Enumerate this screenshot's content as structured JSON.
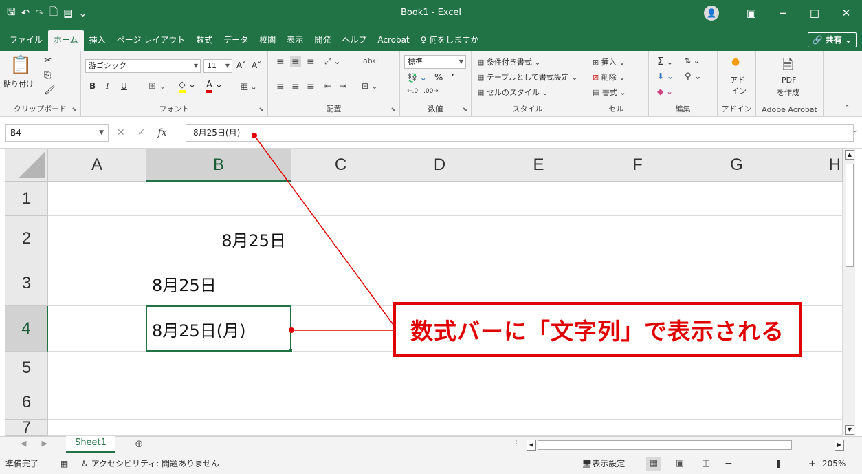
{
  "window": {
    "title": "Book1  -  Excel",
    "avatar_initial": "👤",
    "ribbon_display_icon": "ribbon-display-icon",
    "minimize": "−",
    "maximize": "□",
    "close": "✕"
  },
  "qat": {
    "save": "🖫",
    "undo": "↶",
    "redo": "↷",
    "preview": "🗋",
    "form": "▤",
    "more": "⌄"
  },
  "tabs": [
    "ファイル",
    "ホーム",
    "挿入",
    "ページ レイアウト",
    "数式",
    "データ",
    "校閲",
    "表示",
    "開発",
    "ヘルプ",
    "Acrobat",
    "♀ 何をしますか"
  ],
  "active_tab_index": 1,
  "share_label": "🔗 共有 ⌄",
  "ribbon": {
    "clipboard": {
      "paste": "貼り付け",
      "label": "クリップボード"
    },
    "font": {
      "name": "游ゴシック",
      "size": "11",
      "bold": "B",
      "italic": "I",
      "underline": "U",
      "grow": "Aˆ",
      "shrink": "Aˇ",
      "label": "フォント"
    },
    "alignment": {
      "label": "配置",
      "wrap": "ab\nc↵"
    },
    "number": {
      "format": "標準",
      "percent": "%",
      "comma": "’",
      "label": "数値"
    },
    "styles": {
      "conditional": "条件付き書式 ⌄",
      "table": "テーブルとして書式設定 ⌄",
      "cellstyle": "セルのスタイル ⌄",
      "label": "スタイル"
    },
    "cells": {
      "insert": "挿入",
      "delete": "削除",
      "format": "書式 ⌄",
      "label": "セル"
    },
    "editing": {
      "sum": "Σ",
      "label": "編集"
    },
    "addins": {
      "line1": "アド",
      "line2": "イン",
      "label": "アドイン"
    },
    "acrobat": {
      "line1": "PDF",
      "line2": "を作成",
      "label": "Adobe Acrobat"
    }
  },
  "formula_bar": {
    "name_box": "B4",
    "cancel": "✕",
    "enter": "✓",
    "fx": "fx",
    "content": "8月25日(月)"
  },
  "columns": [
    "A",
    "B",
    "C",
    "D",
    "E",
    "F",
    "G",
    "H"
  ],
  "rows": [
    "1",
    "2",
    "3",
    "4",
    "5",
    "6",
    "7"
  ],
  "cells": {
    "B2": "8月25日",
    "B3": "8月25日",
    "B4": "8月25日(月)"
  },
  "annotation": {
    "text": "数式バーに「文字列」で表示される",
    "color": "#e10000"
  },
  "sheets": {
    "tab": "Sheet1",
    "add": "⊕",
    "prev": "◀",
    "next": "▶"
  },
  "status": {
    "ready": "準備完了",
    "accessibility": "アクセシビリティ: 問題ありません",
    "display_settings": "表示設定",
    "zoom_minus": "−",
    "zoom_plus": "+",
    "zoom": "205%"
  }
}
